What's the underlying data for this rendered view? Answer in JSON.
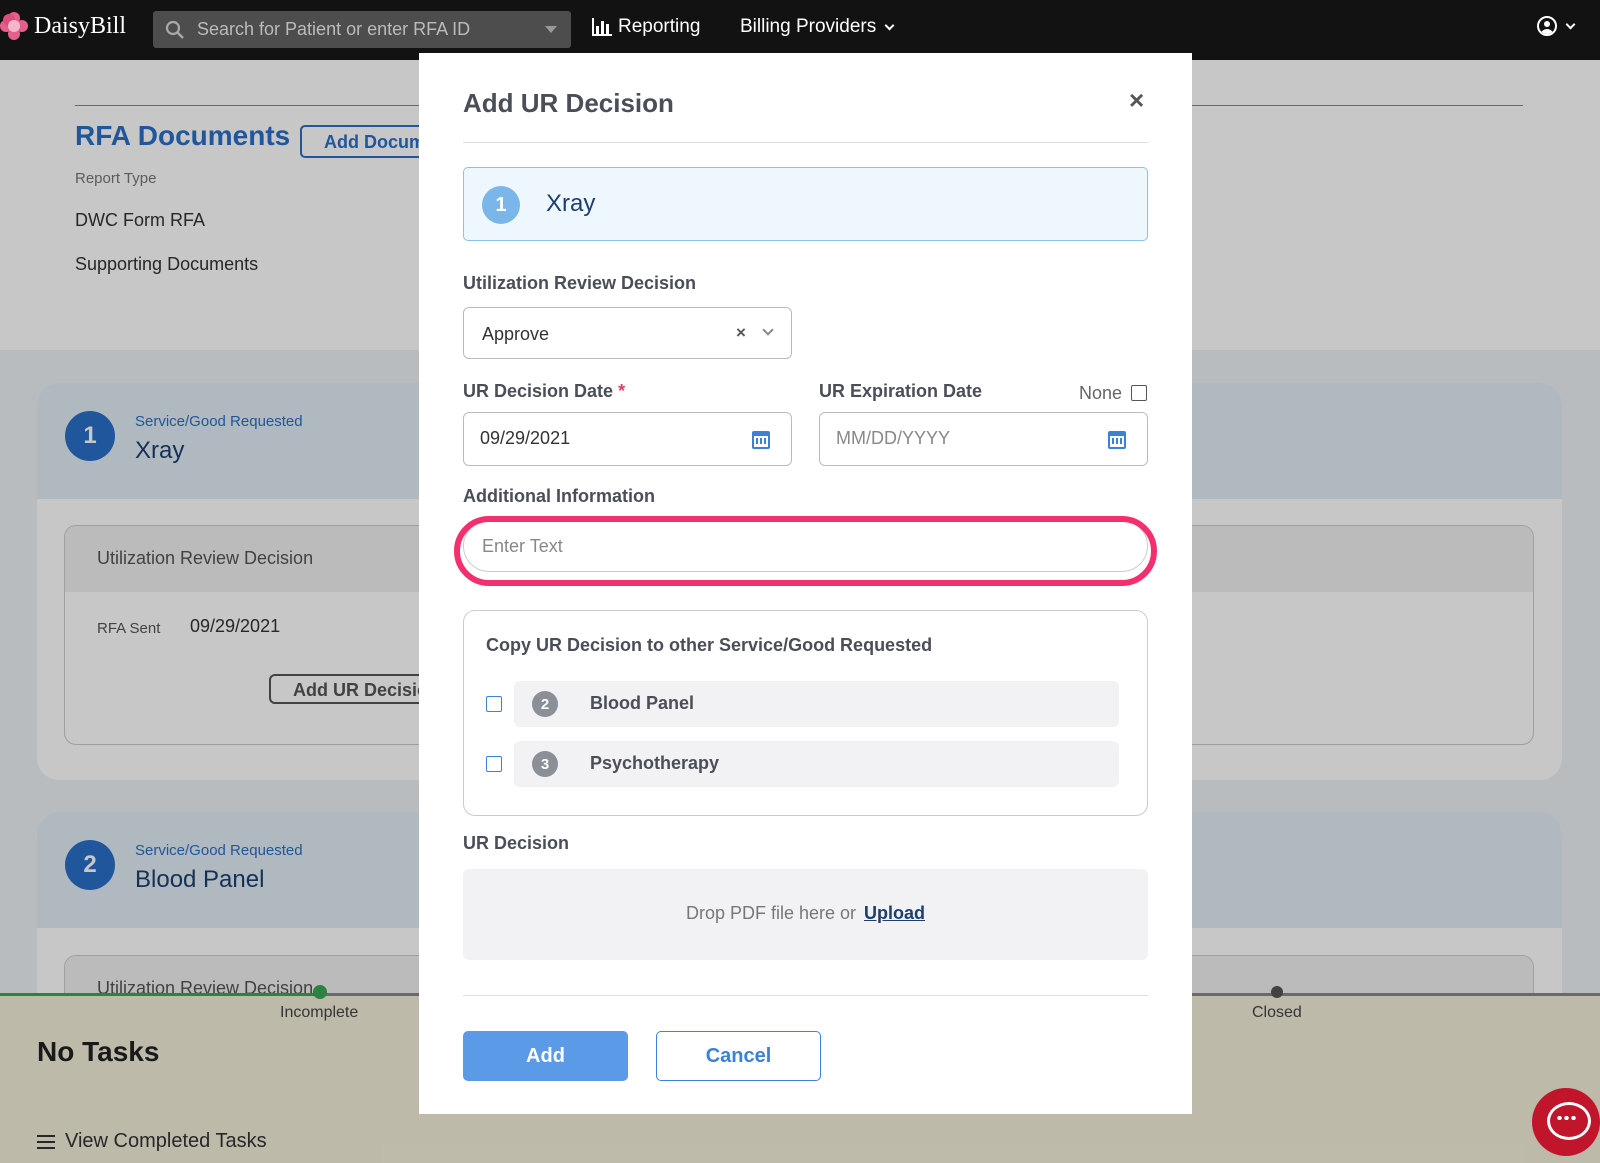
{
  "topbar": {
    "logo_text": "DaisyBill",
    "search_placeholder": "Search for Patient or enter RFA ID",
    "nav": [
      {
        "label": "Reporting",
        "icon": "bar-chart-icon"
      },
      {
        "label": "Billing Providers",
        "icon": "chevron-down-icon"
      }
    ],
    "user_icon": "user-circle-icon"
  },
  "background": {
    "rfa_documents_title": "RFA Documents",
    "add_document_label": "Add Document",
    "report_type_label": "Report Type",
    "documents": [
      "DWC Form RFA",
      "Supporting Documents"
    ],
    "cards": [
      {
        "number": "1",
        "service_label": "Service/Good Requested",
        "service_name": "Xray",
        "ur_decision_label": "Utilization Review Decision",
        "rfa_sent_label": "RFA Sent",
        "rfa_sent_value": "09/29/2021",
        "add_ur_label": "Add UR Decision"
      },
      {
        "number": "2",
        "service_label": "Service/Good Requested",
        "service_name": "Blood Panel",
        "ur_decision_label": "Utilization Review Decision"
      }
    ],
    "tasks": {
      "status_incomplete": "Incomplete",
      "status_closed": "Closed",
      "no_tasks": "No Tasks",
      "view_completed": "View Completed Tasks"
    }
  },
  "modal": {
    "title": "Add UR Decision",
    "close_glyph": "×",
    "service": {
      "number": "1",
      "name": "Xray"
    },
    "ur_decision_label": "Utilization Review Decision",
    "ur_decision_value": "Approve",
    "clear_glyph": "×",
    "decision_date_label": "UR Decision Date",
    "required_mark": "*",
    "decision_date_value": "09/29/2021",
    "expiration_date_label": "UR Expiration Date",
    "expiration_none_label": "None",
    "expiration_placeholder": "MM/DD/YYYY",
    "additional_info_label": "Additional Information",
    "additional_info_placeholder": "Enter Text",
    "copy_title": "Copy UR Decision to other Service/Good Requested",
    "copy_items": [
      {
        "number": "2",
        "name": "Blood Panel"
      },
      {
        "number": "3",
        "name": "Psychotherapy"
      }
    ],
    "ur_file_label": "UR Decision",
    "drop_text": "Drop PDF file here or",
    "upload_label": "Upload",
    "add_button": "Add",
    "cancel_button": "Cancel"
  },
  "colors": {
    "accent": "#2a6fc7",
    "highlight": "#f42f6d",
    "primary_button": "#5a9ae6",
    "chat": "#c1152c"
  }
}
